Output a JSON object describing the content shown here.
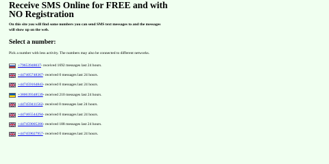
{
  "page": {
    "title_line1": "Receive SMS Online for FREE and with",
    "title_line2": "NO Registration",
    "intro": "On this site you will find some numbers you can send SMS text messages to and the messages will show up on the web.",
    "section_heading": "Select a number:",
    "hint": "Pick a number with less activity. The numbers may also be connected to different networks."
  },
  "numbers": [
    {
      "flag": "russia-flag-icon",
      "number": "+79653948037",
      "info": " - received 1692 messages last 24 hours."
    },
    {
      "flag": "uk-flag-icon",
      "number": "+447405748367",
      "info": " - received 0 messages last 24 hours."
    },
    {
      "flag": "uk-flag-icon",
      "number": "+447459164843",
      "info": " - received 0 messages last 24 hours."
    },
    {
      "flag": "ukraine-flag-icon",
      "number": "+380639348539",
      "info": " - received 210 messages last 24 hours."
    },
    {
      "flag": "uk-flag-icon",
      "number": "+447459411562",
      "info": " - received 0 messages last 24 hours."
    },
    {
      "flag": "uk-flag-icon",
      "number": "+447465544294",
      "info": " - received 0 messages last 24 hours."
    },
    {
      "flag": "uk-flag-icon",
      "number": "+447459005206",
      "info": " - received 188 messages last 24 hours."
    },
    {
      "flag": "uk-flag-icon",
      "number": "+447459027957",
      "info": " - received 0 messages last 24 hours."
    }
  ]
}
